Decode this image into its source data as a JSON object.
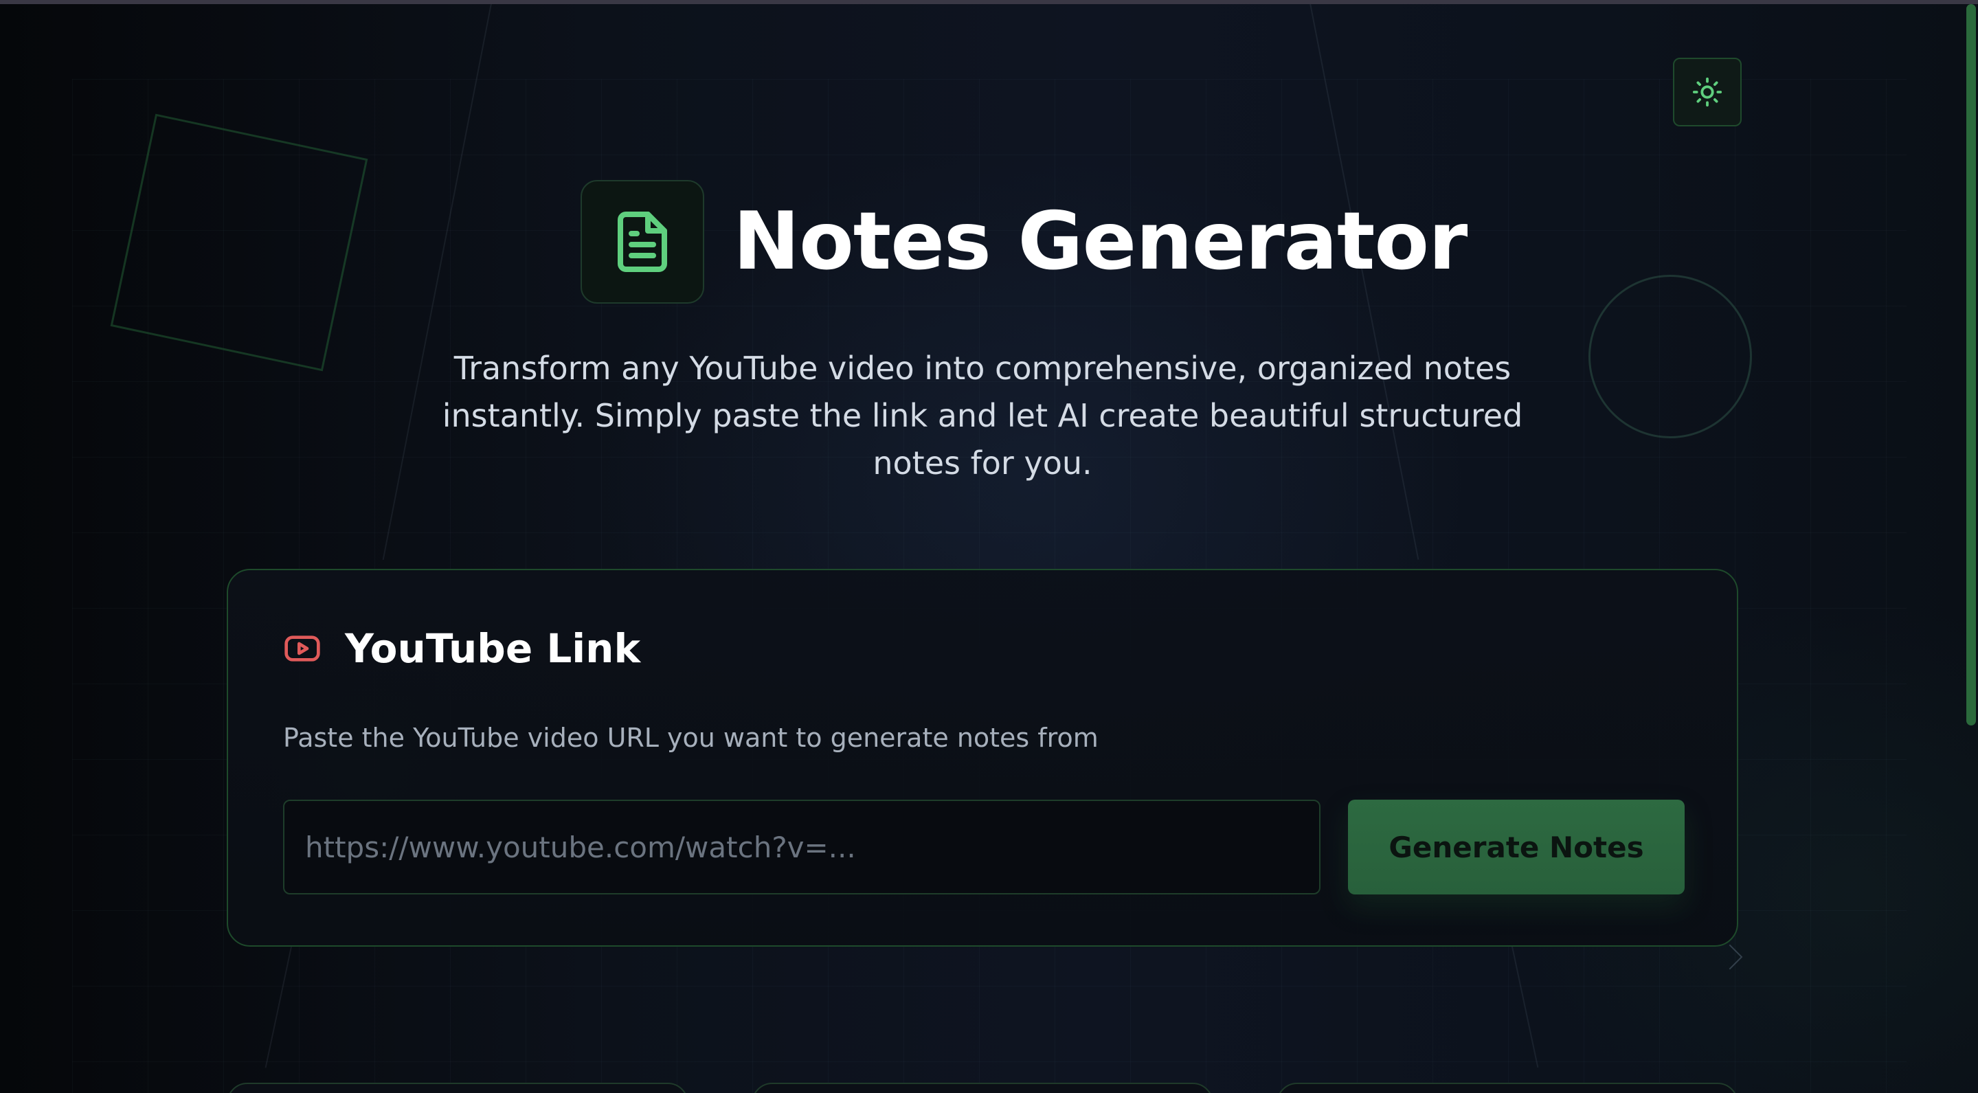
{
  "header": {
    "title": "Notes Generator",
    "logo_icon": "document-icon",
    "subtitle": "Transform any YouTube video into comprehensive, organized notes instantly. Simply paste the link and let AI create beautiful structured notes for you."
  },
  "theme_toggle": {
    "icon": "sun-icon"
  },
  "card": {
    "icon": "youtube-icon",
    "title": "YouTube Link",
    "description": "Paste the YouTube video URL you want to generate notes from",
    "input_value": "",
    "input_placeholder": "https://www.youtube.com/watch?v=...",
    "button_label": "Generate Notes"
  },
  "colors": {
    "accent": "#5fcf7e",
    "button": "#2d6a41",
    "youtube_icon": "#e05a5a",
    "background": "#0c111a"
  }
}
